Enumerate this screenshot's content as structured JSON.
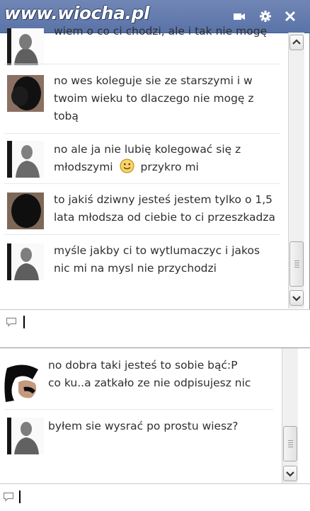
{
  "watermark": "www.wiocha.pl",
  "colors": {
    "titlebar": "#5a73a8",
    "text": "#2f2f2f",
    "separator": "#e6e8ee"
  },
  "titlebar": {
    "icons": [
      "video-icon",
      "gear-icon",
      "close-icon"
    ]
  },
  "chat1": {
    "messages": [
      {
        "sender": "boy",
        "text": [
          "wiem o co ci chodzi, ale i tak nie mogę"
        ]
      },
      {
        "sender": "girl",
        "text": [
          "no wes koleguje sie ze starszymi i w",
          "twoim wieku to dlaczego nie mogę z",
          "tobą"
        ]
      },
      {
        "sender": "boy",
        "text": [
          "no ale ja nie lubię kolegować się z",
          "młodszymi",
          "przykro mi"
        ]
      },
      {
        "sender": "girl",
        "text": [
          "to jakiś dziwny jesteś jestem tylko o 1,5",
          "lata młodsza od ciebie to ci przeszkadza"
        ]
      },
      {
        "sender": "boy",
        "text": [
          "myśle jakby ci to wytlumaczyc i jakos",
          "nic mi na mysl nie przychodzi"
        ]
      }
    ]
  },
  "chat2": {
    "messages": [
      {
        "sender": "girl",
        "text": [
          "no dobra taki jesteś to sobie bąć:P",
          "co ku..a zatkało ze nie odpisujesz nic"
        ]
      },
      {
        "sender": "boy",
        "text": [
          "byłem sie wysrać po prostu wiesz?"
        ]
      }
    ]
  }
}
